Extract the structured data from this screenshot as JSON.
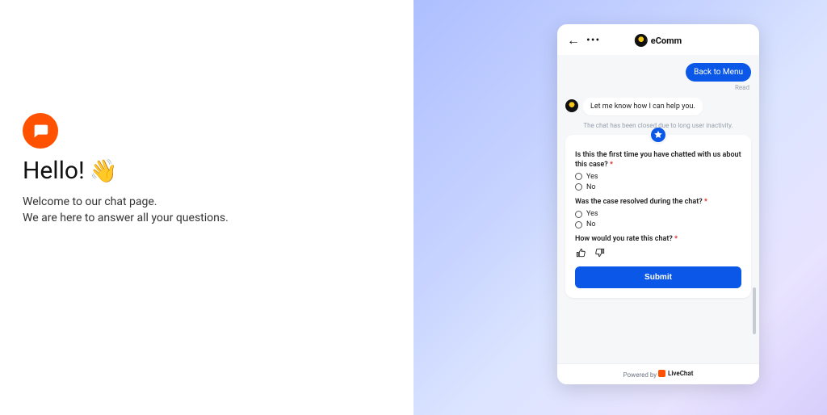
{
  "left": {
    "heading": "Hello!",
    "wave_emoji": "👋",
    "welcome_line1": "Welcome to our chat page.",
    "welcome_line2": "We are here to answer all your questions."
  },
  "chat": {
    "brand_name": "eComm",
    "back_to_menu": "Back to Menu",
    "read_label": "Read",
    "agent_message": "Let me know how I can help you.",
    "closed_notice": "The chat has been closed due to long user inactivity.",
    "survey": {
      "q1": {
        "text": "Is this the first time you have chatted with us about this case?",
        "required": "*",
        "options": [
          "Yes",
          "No"
        ]
      },
      "q2": {
        "text": "Was the case resolved during the chat?",
        "required": "*",
        "options": [
          "Yes",
          "No"
        ]
      },
      "q3": {
        "text": "How would you rate this chat?",
        "required": "*"
      },
      "submit_label": "Submit"
    },
    "footer_prefix": "Powered by",
    "footer_brand": "LiveChat"
  },
  "colors": {
    "accent": "#0a57e8",
    "orange": "#ff5100"
  }
}
